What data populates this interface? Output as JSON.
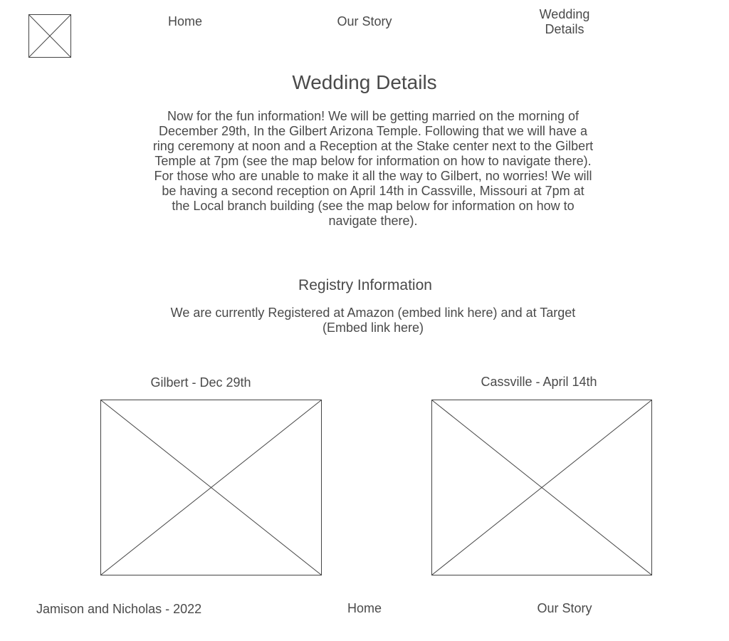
{
  "header": {
    "logo_icon": "image-placeholder-icon",
    "nav": {
      "home": "Home",
      "our_story": "Our Story",
      "wedding_details_line1": "Wedding",
      "wedding_details_line2": "Details"
    }
  },
  "main": {
    "title": "Wedding Details",
    "details_paragraph": "Now for the fun information! We will be getting married on the morning of December 29th, In the Gilbert Arizona Temple. Following that we will have a ring ceremony at noon and a Reception at the Stake center next to the Gilbert Temple at 7pm (see the map below for information on how to navigate there). For those who are unable to make it all the way to Gilbert, no worries! We will be having a second reception on April 14th in Cassville, Missouri at 7pm at the Local branch building (see the map below for information on how to navigate there).",
    "registry": {
      "title": "Registry Information",
      "text": "We are currently Registered at Amazon (embed link here) and at Target (Embed link here)"
    },
    "maps": [
      {
        "caption": "Gilbert - Dec 29th",
        "icon": "map-placeholder-icon"
      },
      {
        "caption": "Cassville - April 14th",
        "icon": "map-placeholder-icon"
      }
    ]
  },
  "footer": {
    "copyright": "Jamison and Nicholas - 2022",
    "home": "Home",
    "our_story": "Our Story"
  }
}
